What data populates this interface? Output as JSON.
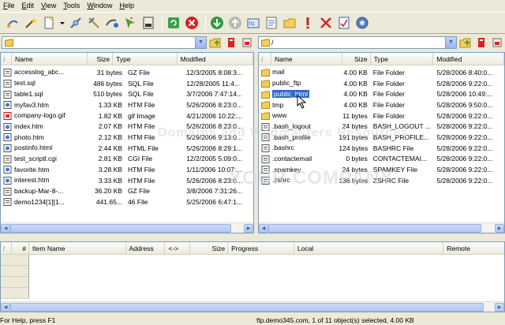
{
  "menu": [
    "File",
    "Edit",
    "View",
    "Tools",
    "Window",
    "Help"
  ],
  "toolbar_icons": [
    "connect-icon",
    "quick-connect-wand-icon",
    "new-file-icon",
    "dropdown-arrow-icon",
    "link-icon",
    "disconnect-icon",
    "ftp-tool-icon",
    "bookmark-icon",
    "site-manager-icon",
    "refresh-icon",
    "stop-icon",
    "download-icon",
    "upload-icon",
    "binary-icon",
    "properties-icon",
    "new-folder-icon",
    "exclamation-icon",
    "delete-icon",
    "edit-icon",
    "settings-icon"
  ],
  "local": {
    "path": "",
    "columns": [
      "Name",
      "Size",
      "Type",
      "Modified"
    ],
    "files": [
      {
        "name": "accesslog_abc...",
        "size": "31 bytes",
        "type": "GZ File",
        "modified": "12/3/2005 8:08:3..."
      },
      {
        "name": "test.sql",
        "size": "486 bytes",
        "type": "SQL File",
        "modified": "12/28/2005 11:4..."
      },
      {
        "name": "table1.sql",
        "size": "510 bytes",
        "type": "SQL File",
        "modified": "3/7/2006 7:47:14..."
      },
      {
        "name": "myfav3.htm",
        "size": "1.33 KB",
        "type": "HTM File",
        "modified": "5/26/2006 8:23:0..."
      },
      {
        "name": "company-logo.gif",
        "size": "1.82 KB",
        "type": "gif Image",
        "modified": "4/21/2006 10:22:..."
      },
      {
        "name": "index.htm",
        "size": "2.07 KB",
        "type": "HTM File",
        "modified": "5/26/2006 8:23:0..."
      },
      {
        "name": "photo.htm",
        "size": "2.12 KB",
        "type": "HTM File",
        "modified": "5/29/2006 9:13:0..."
      },
      {
        "name": "postinfo.html",
        "size": "2.44 KB",
        "type": "HTML File",
        "modified": "5/26/2006 8:29:1..."
      },
      {
        "name": "test_scriptl.cgi",
        "size": "2.81 KB",
        "type": "CGI File",
        "modified": "12/2/2005 5:09:0..."
      },
      {
        "name": "favorite.htm",
        "size": "3.28 KB",
        "type": "HTM File",
        "modified": "1/11/2006 10:07:..."
      },
      {
        "name": "interest.htm",
        "size": "3.33 KB",
        "type": "HTM File",
        "modified": "5/26/2006 8:23:0..."
      },
      {
        "name": "backup-Mar-8-...",
        "size": "36.20 KB",
        "type": "GZ File",
        "modified": "3/8/2006 7:31:26..."
      },
      {
        "name": "demo1234[1][1...",
        "size": "441.65...",
        "type": "46 File",
        "modified": "5/25/2006 6:47:1..."
      }
    ]
  },
  "remote": {
    "path": "/",
    "columns": [
      "Name",
      "Size",
      "Type",
      "Modified"
    ],
    "files": [
      {
        "name": "mail",
        "size": "4.00 KB",
        "type": "File Folder",
        "modified": "5/28/2006 8:40:0...",
        "folder": true
      },
      {
        "name": "public_ftp",
        "size": "4.00 KB",
        "type": "File Folder",
        "modified": "5/28/2006 9:22:0...",
        "folder": true
      },
      {
        "name": "public_html",
        "size": "4.00 KB",
        "type": "File Folder",
        "modified": "5/28/2006 10:49:...",
        "folder": true,
        "selected": true
      },
      {
        "name": "tmp",
        "size": "4.00 KB",
        "type": "File Folder",
        "modified": "5/28/2006 9:50:0...",
        "folder": true
      },
      {
        "name": "www",
        "size": "11 bytes",
        "type": "File Folder",
        "modified": "5/28/2006 9:22:0...",
        "folder": true
      },
      {
        "name": ".bash_logout",
        "size": "24 bytes",
        "type": "BASH_LOGOUT ...",
        "modified": "5/28/2006 9:22:0..."
      },
      {
        "name": ".bash_profile",
        "size": "191 bytes",
        "type": "BASH_PROFILE...",
        "modified": "5/28/2006 9:22:0..."
      },
      {
        "name": ".bashrc",
        "size": "124 bytes",
        "type": "BASHRC File",
        "modified": "5/28/2006 9:22:0..."
      },
      {
        "name": ".contactemail",
        "size": "0 bytes",
        "type": "CONTACTEMAI...",
        "modified": "5/28/2006 9:22:0..."
      },
      {
        "name": ".spamkey",
        "size": "24 bytes",
        "type": "SPAMKEY File",
        "modified": "5/28/2006 9:22:0..."
      },
      {
        "name": ".zshrc",
        "size": "136 bytes",
        "type": "ZSHRC File",
        "modified": "5/28/2006 9:22:0..."
      }
    ]
  },
  "queue": {
    "columns": [
      "#",
      "Item Name",
      "Address",
      "<->",
      "Size",
      "Progress",
      "Local",
      "Remote"
    ]
  },
  "status": {
    "left": "For Help, press F1",
    "right": "ftp.demo345.com, 1 of 11 object(s) selected, 4.00 KB"
  },
  "watermark": {
    "line1": "Domains and Webmasters Resources",
    "line2": "YOUR COMPANY"
  },
  "colors": {
    "selection": "#316ac5",
    "window_bg": "#ece9d8",
    "border": "#7f9db9"
  }
}
